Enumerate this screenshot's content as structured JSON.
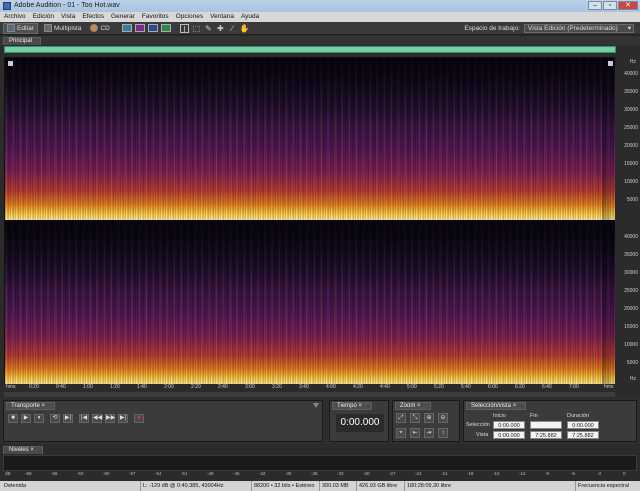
{
  "window": {
    "title": "Adobe Audition - 01 - Too Hot.wav"
  },
  "menu": [
    "Archivo",
    "Edición",
    "Vista",
    "Efectos",
    "Generar",
    "Favoritos",
    "Opciones",
    "Ventana",
    "Ayuda"
  ],
  "toolbar": {
    "edit_label": "Editar",
    "multitrack_label": "Multipista",
    "cd_label": "CD",
    "workspace_label": "Espacio de trabajo:",
    "workspace_value": "Vista Edición (Predeterminado)"
  },
  "main_tab": "Principal",
  "freq_axis": {
    "unit": "Hz",
    "ch1_labels": [
      "40000",
      "35000",
      "30000",
      "25000",
      "20000",
      "15000",
      "10000",
      "5000"
    ],
    "ch2_labels": [
      "40000",
      "35000",
      "30000",
      "25000",
      "20000",
      "15000",
      "10000",
      "5000"
    ]
  },
  "time_axis": {
    "unit_left": "hms",
    "unit_right": "hms",
    "labels": [
      "0:20",
      "0:40",
      "1:00",
      "1:20",
      "1:40",
      "2:00",
      "2:20",
      "2:40",
      "3:00",
      "3:20",
      "3:40",
      "4:00",
      "4:20",
      "4:40",
      "5:00",
      "5:20",
      "5:40",
      "6:00",
      "6:20",
      "6:40",
      "7:00"
    ]
  },
  "panels": {
    "transport": {
      "tab": "Transporte",
      "buttons": [
        "■",
        "▶",
        "⏸",
        "⟲",
        "▶|",
        "|◀",
        "◀◀",
        "▶▶",
        "▶|",
        "●"
      ]
    },
    "time": {
      "tab": "Tiempo",
      "value": "0:00.000"
    },
    "zoom": {
      "tab": "Zoom"
    },
    "selection": {
      "tab": "Selección/vista",
      "headers": [
        "Inicio",
        "Fin",
        "Duración"
      ],
      "rows": [
        {
          "label": "Selección",
          "start": "0:00.000",
          "end": "",
          "duration": "0:00.000"
        },
        {
          "label": "Vista",
          "start": "0:00.000",
          "end": "7:25.882",
          "duration": "7:25.882"
        }
      ]
    }
  },
  "levels": {
    "tab": "Niveles",
    "db_labels": [
      "dB",
      "-69",
      "-66",
      "-63",
      "-60",
      "-57",
      "-54",
      "-51",
      "-48",
      "-45",
      "-42",
      "-39",
      "-36",
      "-33",
      "-30",
      "-27",
      "-24",
      "-21",
      "-18",
      "-15",
      "-12",
      "-9",
      "-6",
      "-3",
      "0"
    ]
  },
  "status": {
    "state": "Detenida",
    "cursor": "L: -129 dB @ 0:40.385, 43004Hz",
    "format": "88200 • 32 bits • Estéreo",
    "size": "300.03 MB",
    "free": "426.93 GB libre",
    "free_time": "180:28:09.30 libre",
    "view": "Frecuencia espectral"
  }
}
